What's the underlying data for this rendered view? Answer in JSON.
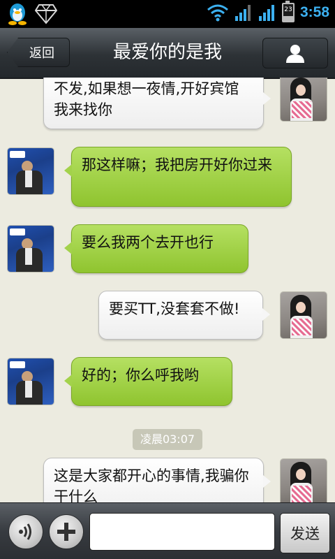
{
  "status_bar": {
    "time": "3:58",
    "battery_level_text": "23",
    "icons": [
      "qq-penguin-icon",
      "diamond-icon",
      "wifi-icon",
      "signal-icon",
      "signal-icon",
      "battery-icon"
    ]
  },
  "header": {
    "back_label": "返回",
    "title": "最爱你的是我",
    "profile_icon": "person-icon"
  },
  "messages": [
    {
      "side": "right",
      "text": "不发,如果想一夜情,开好宾馆我来找你"
    },
    {
      "side": "left",
      "text": "那这样嘛；我把房开好你过来"
    },
    {
      "side": "left",
      "text": "要么我两个去开也行"
    },
    {
      "side": "right",
      "text": "要买TT,没套套不做!"
    },
    {
      "side": "left",
      "text": "好的；你么呼我哟"
    },
    {
      "side": "right",
      "text": "这是大家都开心的事情,我骗你干什么"
    }
  ],
  "timestamp": "凌晨03:07",
  "input_bar": {
    "voice_icon": "voice-icon",
    "plus_icon": "plus-icon",
    "input_value": "",
    "input_placeholder": "",
    "send_label": "发送"
  },
  "colors": {
    "chat_background": "#ecebe0",
    "left_bubble": "#a3d24b",
    "right_bubble": "#f6f6f6",
    "time_accent": "#3cb0f0"
  }
}
